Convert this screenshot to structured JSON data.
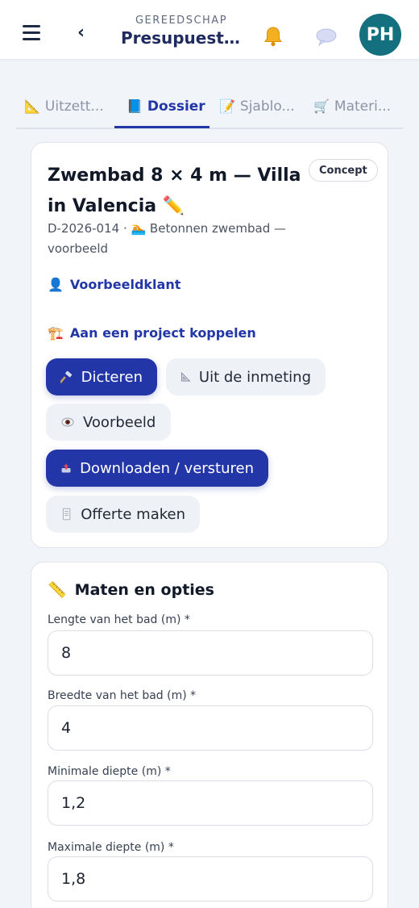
{
  "header": {
    "subtitle": "GEREEDSCHAP",
    "title": "Presupuest...",
    "avatar_initials": "PH",
    "avatar_color": "#14707f"
  },
  "tabs": [
    {
      "icon": "📐",
      "label": "Uitzett..."
    },
    {
      "icon": "📘",
      "label": "Dossier",
      "active": true
    },
    {
      "icon": "📝",
      "label": "Sjablo..."
    },
    {
      "icon": "🛒",
      "label": "Materi..."
    }
  ],
  "dossier": {
    "title": "Zwembad 8 × 4 m — Villa in Valencia ✏️",
    "status_badge": "Concept",
    "meta": "D-2026-014 · 🏊 Betonnen zwembad — voorbeeld",
    "client_link": "Voorbeeldklant",
    "client_icon": "👤",
    "project_link": "Aan een project koppelen",
    "project_icon": "🏗️",
    "buttons": {
      "dicteren": "Dicteren",
      "inmeting": "Uit de inmeting",
      "voorbeeld": "Voorbeeld",
      "download": "Downloaden / versturen",
      "offerte": "Offerte maken"
    }
  },
  "form": {
    "section_title": "Maten en opties",
    "section_icon": "📏",
    "fields": [
      {
        "label": "Lengte van het bad (m) *",
        "value": "8"
      },
      {
        "label": "Breedte van het bad (m) *",
        "value": "4"
      },
      {
        "label": "Minimale diepte (m) *",
        "value": "1,2"
      },
      {
        "label": "Maximale diepte (m) *",
        "value": "1,8"
      }
    ]
  },
  "colors": {
    "accent": "#2336a8",
    "background": "#f1f4f8"
  }
}
